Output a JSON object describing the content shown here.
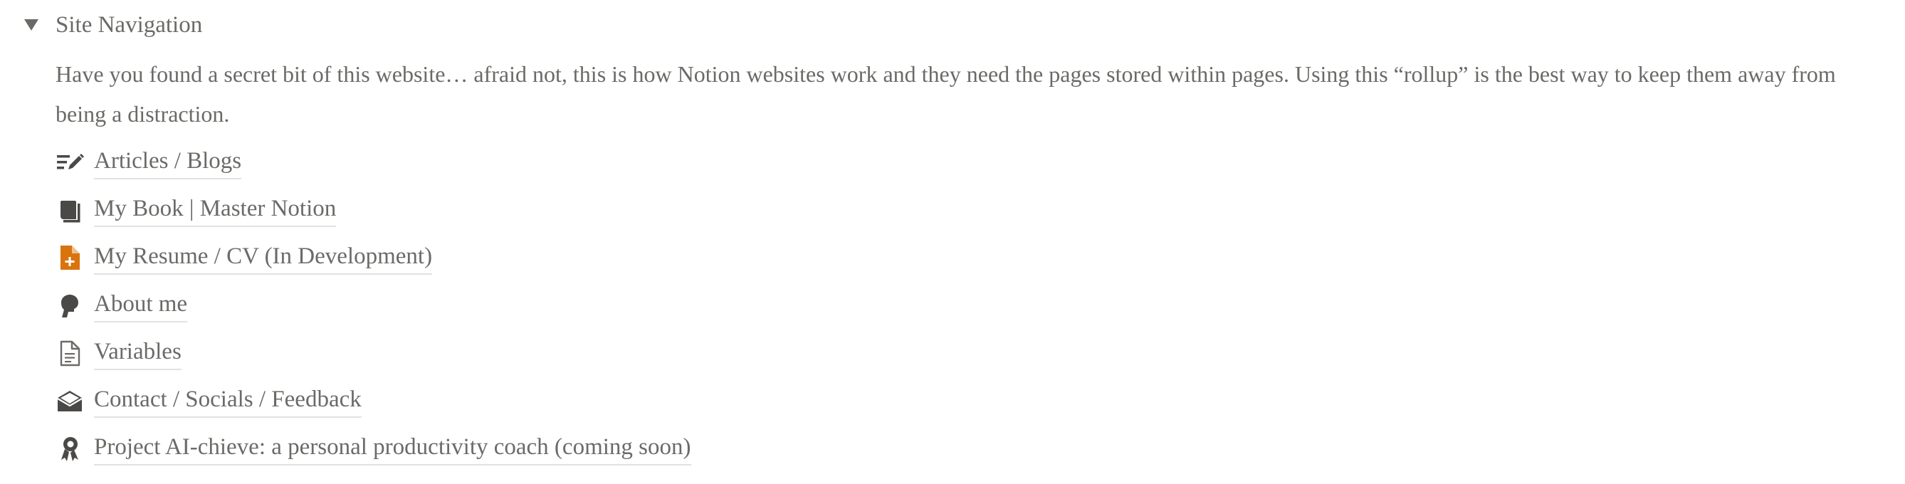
{
  "toggle": {
    "title": "Site Navigation",
    "expanded": true,
    "arrow_icon": "triangle-down-icon"
  },
  "description": "Have you found a secret bit of this website… afraid not, this is how Notion websites work and they need the pages stored within pages.  Using this “rollup” is the best way to keep them away from being a distraction.",
  "colors": {
    "text": "#6b6a67",
    "icon_dark": "#4a4947",
    "icon_orange": "#d9730d",
    "underline": "#e3e2df"
  },
  "pages": [
    {
      "label": "Articles / Blogs",
      "icon": "edit-list-icon"
    },
    {
      "label": "My Book | Master Notion",
      "icon": "book-icon"
    },
    {
      "label": "My Resume / CV (In Development)",
      "icon": "document-add-icon"
    },
    {
      "label": "About me",
      "icon": "person-icon"
    },
    {
      "label": "Variables",
      "icon": "page-icon"
    },
    {
      "label": "Contact / Socials / Feedback",
      "icon": "mail-open-icon"
    },
    {
      "label": "Project AI-chieve: a personal productivity coach (coming soon)",
      "icon": "award-ribbon-icon"
    }
  ]
}
